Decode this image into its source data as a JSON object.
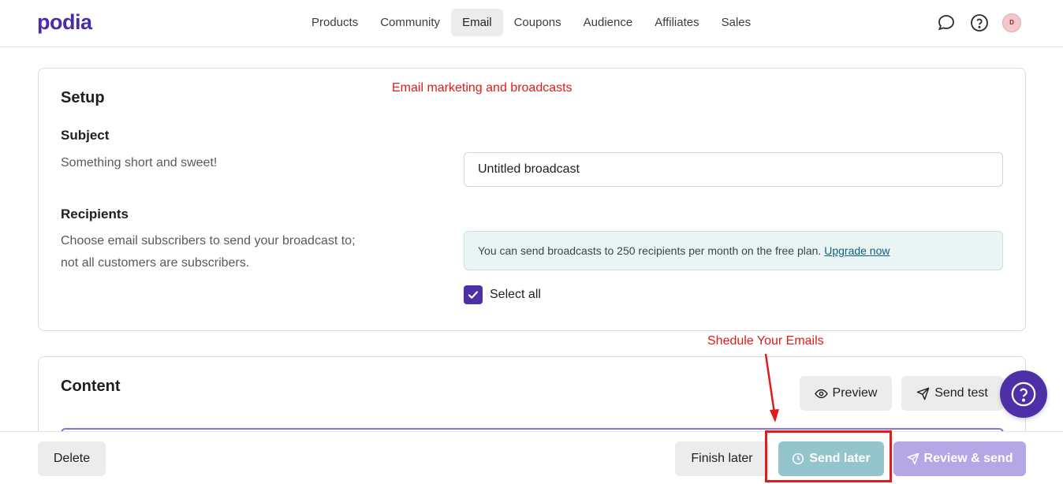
{
  "header": {
    "logo": "podia",
    "nav": [
      {
        "label": "Products",
        "active": false
      },
      {
        "label": "Community",
        "active": false
      },
      {
        "label": "Email",
        "active": true
      },
      {
        "label": "Coupons",
        "active": false
      },
      {
        "label": "Audience",
        "active": false
      },
      {
        "label": "Affiliates",
        "active": false
      },
      {
        "label": "Sales",
        "active": false
      }
    ],
    "avatar_initial": "D",
    "icons": [
      "chat-bubble-icon",
      "help-circle-icon"
    ]
  },
  "annotations": {
    "top": "Email marketing and broadcasts",
    "schedule": "Shedule Your Emails"
  },
  "setup": {
    "title": "Setup",
    "subject": {
      "label": "Subject",
      "help": "Something short and sweet!",
      "value": "Untitled broadcast"
    },
    "recipients": {
      "label": "Recipients",
      "help": "Choose email subscribers to send your broadcast to; not all customers are subscribers.",
      "notice": "You can send broadcasts to 250 recipients per month on the free plan.",
      "notice_link": "Upgrade now",
      "select_all_label": "Select all",
      "select_all_checked": true
    }
  },
  "content": {
    "title": "Content",
    "preview_label": "Preview",
    "send_test_label": "Send test"
  },
  "footer": {
    "delete_label": "Delete",
    "finish_later_label": "Finish later",
    "send_later_label": "Send later",
    "review_send_label": "Review & send"
  },
  "colors": {
    "brand": "#4b2ca8",
    "send_later_bg": "#95c5cc",
    "review_send_bg": "#b5a6e6",
    "annotation": "#e01b1b"
  }
}
